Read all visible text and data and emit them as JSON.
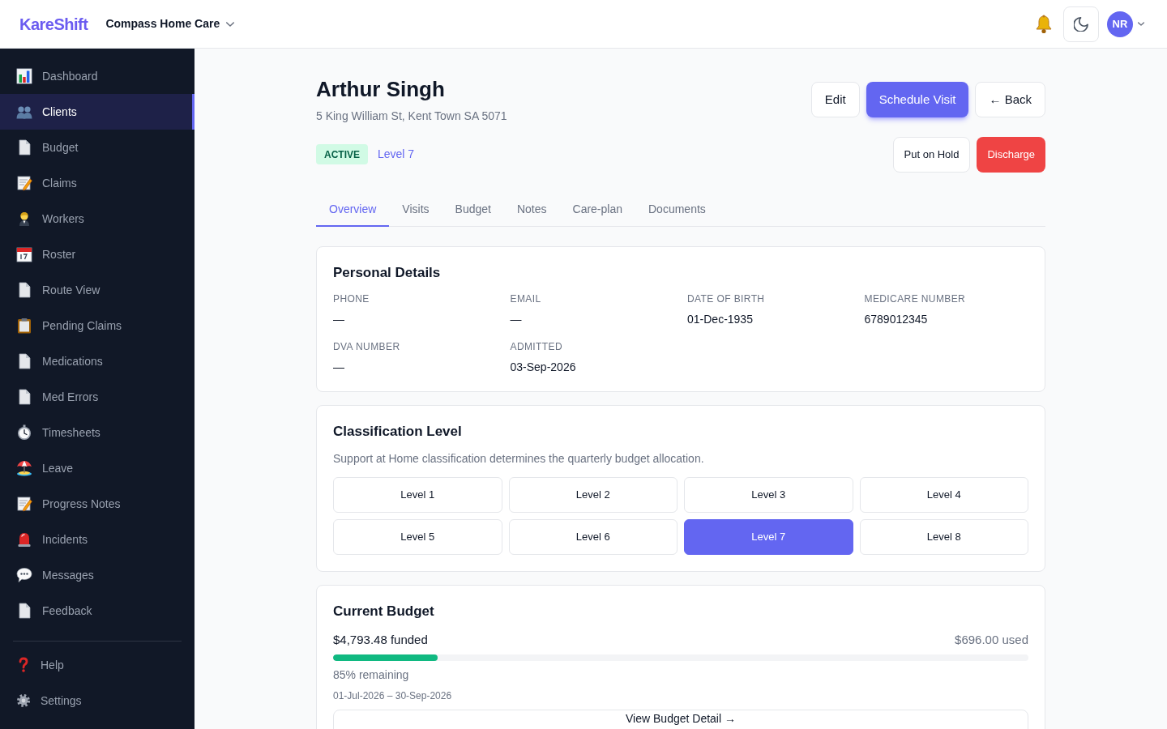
{
  "topbar": {
    "logo": "KareShift",
    "organization": "Compass Home Care",
    "user_initials": "NR"
  },
  "sidebar": {
    "items": [
      {
        "label": "Dashboard",
        "selected": false
      },
      {
        "label": "Clients",
        "selected": true
      },
      {
        "label": "Budget",
        "selected": false
      },
      {
        "label": "Claims",
        "selected": false
      },
      {
        "label": "Workers",
        "selected": false
      },
      {
        "label": "Roster",
        "selected": false
      },
      {
        "label": "Route View",
        "selected": false
      },
      {
        "label": "Pending Claims",
        "selected": false
      },
      {
        "label": "Medications",
        "selected": false
      },
      {
        "label": "Med Errors",
        "selected": false
      },
      {
        "label": "Timesheets",
        "selected": false
      },
      {
        "label": "Leave",
        "selected": false
      },
      {
        "label": "Progress Notes",
        "selected": false
      },
      {
        "label": "Incidents",
        "selected": false
      },
      {
        "label": "Messages",
        "selected": false
      },
      {
        "label": "Feedback",
        "selected": false
      }
    ],
    "footer_items": [
      {
        "label": "Help"
      },
      {
        "label": "Settings"
      }
    ]
  },
  "client": {
    "name": "Arthur Singh",
    "address": "5 King William St, Kent Town SA 5071",
    "status": "ACTIVE",
    "level": "Level 7"
  },
  "actions": {
    "primary": [
      {
        "label": "Edit",
        "kind": "outline"
      },
      {
        "label": "Schedule Visit",
        "kind": "primary"
      },
      {
        "label": "← Back",
        "kind": "outline"
      }
    ],
    "secondary": [
      {
        "label": "Put on Hold",
        "kind": "outline"
      },
      {
        "label": "Discharge",
        "kind": "danger"
      }
    ]
  },
  "tabs": [
    {
      "label": "Overview",
      "selected": true
    },
    {
      "label": "Visits",
      "selected": false
    },
    {
      "label": "Budget",
      "selected": false
    },
    {
      "label": "Notes",
      "selected": false
    },
    {
      "label": "Care-plan",
      "selected": false
    },
    {
      "label": "Documents",
      "selected": false
    }
  ],
  "personal_details": {
    "title": "Personal Details",
    "fields": [
      {
        "label": "PHONE",
        "value": "—"
      },
      {
        "label": "EMAIL",
        "value": "—"
      },
      {
        "label": "DATE OF BIRTH",
        "value": "01-Dec-1935"
      },
      {
        "label": "MEDICARE NUMBER",
        "value": "6789012345"
      },
      {
        "label": "DVA NUMBER",
        "value": "—"
      },
      {
        "label": "ADMITTED",
        "value": "03-Sep-2026"
      }
    ]
  },
  "classification": {
    "title": "Classification Level",
    "description": "Support at Home classification determines the quarterly budget allocation.",
    "levels": [
      {
        "label": "Level 1",
        "selected": false
      },
      {
        "label": "Level 2",
        "selected": false
      },
      {
        "label": "Level 3",
        "selected": false
      },
      {
        "label": "Level 4",
        "selected": false
      },
      {
        "label": "Level 5",
        "selected": false
      },
      {
        "label": "Level 6",
        "selected": false
      },
      {
        "label": "Level 7",
        "selected": true
      },
      {
        "label": "Level 8",
        "selected": false
      }
    ]
  },
  "budget": {
    "title": "Current Budget",
    "funded": "$4,793.48 funded",
    "used": "$696.00 used",
    "level": 0.15,
    "remaining": "85% remaining",
    "period": "01-Jul-2026 – 30-Sep-2026",
    "button": "View Budget Detail →"
  }
}
